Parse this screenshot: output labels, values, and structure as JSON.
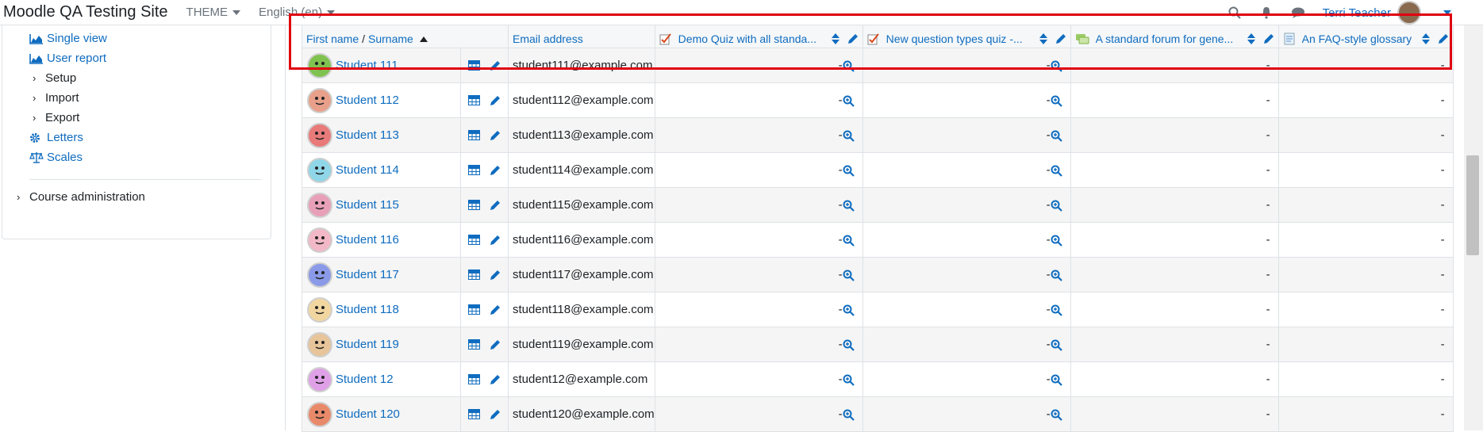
{
  "navbar": {
    "brand": "Moodle QA Testing Site",
    "theme_label": "THEME",
    "language_label": "English (en)",
    "user_name": "Terri Teacher"
  },
  "drawer": {
    "items": [
      {
        "label": "Single view",
        "icon": "chart-icon",
        "type": "link"
      },
      {
        "label": "User report",
        "icon": "chart-icon",
        "type": "link"
      },
      {
        "label": "Setup",
        "icon": "chevron-right-icon",
        "type": "collapsible"
      },
      {
        "label": "Import",
        "icon": "chevron-right-icon",
        "type": "collapsible"
      },
      {
        "label": "Export",
        "icon": "chevron-right-icon",
        "type": "collapsible"
      },
      {
        "label": "Letters",
        "icon": "gear-icon",
        "type": "link"
      },
      {
        "label": "Scales",
        "icon": "balance-icon",
        "type": "link"
      }
    ],
    "course_admin": "Course administration"
  },
  "table": {
    "headers": {
      "first_name": "First name",
      "separator": "/",
      "surname": "Surname",
      "email": "Email address",
      "col1": "Demo Quiz with all standa...",
      "col2": "New question types quiz -...",
      "col3": "A standard forum for gene...",
      "col4": "An FAQ-style glossary"
    },
    "dash": "-",
    "rows": [
      {
        "name": "Student 111",
        "email": "student111@example.com",
        "face": "#7fc24f"
      },
      {
        "name": "Student 112",
        "email": "student112@example.com",
        "face": "#e8a08a"
      },
      {
        "name": "Student 113",
        "email": "student113@example.com",
        "face": "#e87a7a"
      },
      {
        "name": "Student 114",
        "email": "student114@example.com",
        "face": "#8fd6e8"
      },
      {
        "name": "Student 115",
        "email": "student115@example.com",
        "face": "#e8a0b8"
      },
      {
        "name": "Student 116",
        "email": "student116@example.com",
        "face": "#f2b8c8"
      },
      {
        "name": "Student 117",
        "email": "student117@example.com",
        "face": "#8a9ae8"
      },
      {
        "name": "Student 118",
        "email": "student118@example.com",
        "face": "#f2d6a0"
      },
      {
        "name": "Student 119",
        "email": "student119@example.com",
        "face": "#e8c49a"
      },
      {
        "name": "Student 12",
        "email": "student12@example.com",
        "face": "#e0a0e8"
      },
      {
        "name": "Student 120",
        "email": "student120@example.com",
        "face": "#e88a6a"
      }
    ]
  },
  "colors": {
    "link": "#0f6cbf",
    "highlight": "#e0000f",
    "row_odd": "#f5f5f5",
    "border": "#dee2e6"
  }
}
